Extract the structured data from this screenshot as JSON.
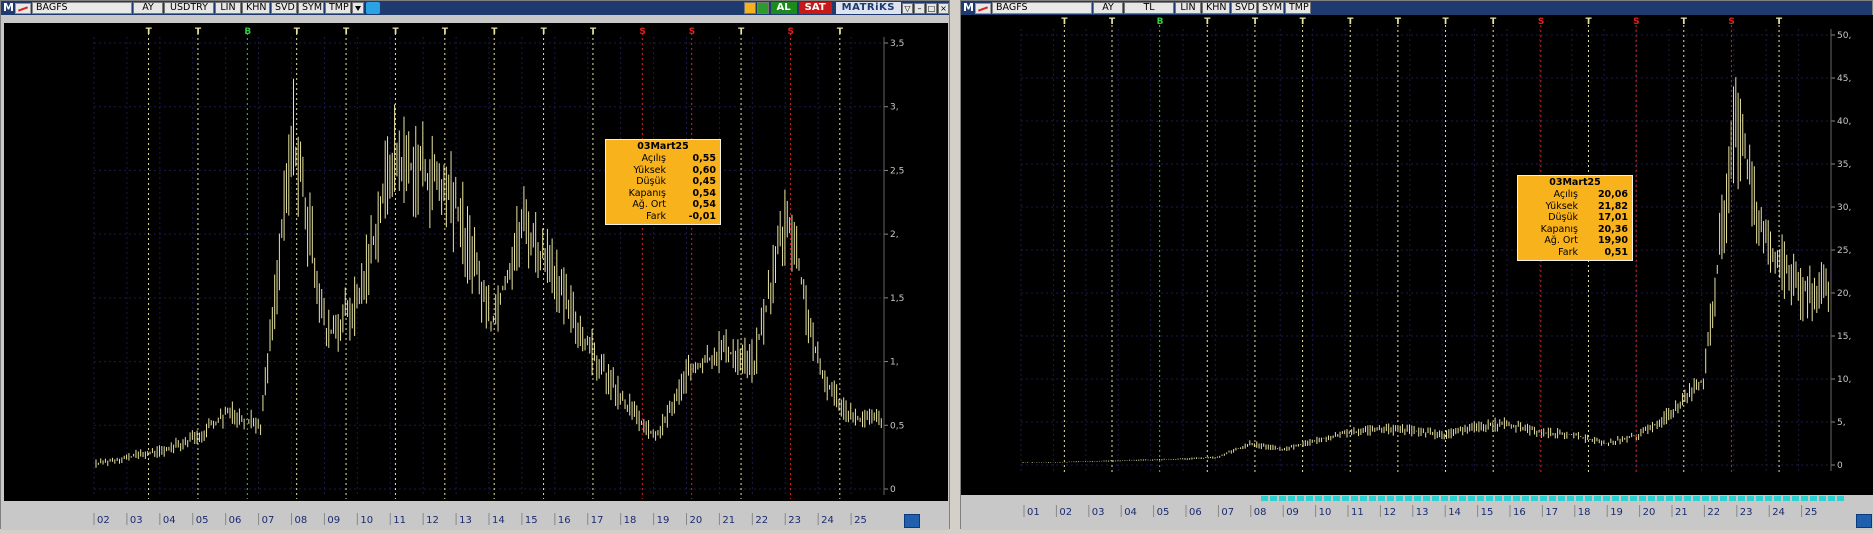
{
  "left": {
    "toolbar": {
      "logo": "M",
      "symbol": "BAGFS",
      "buttons": [
        "AY",
        "USDTRY",
        "LIN",
        "KHN",
        "SVD",
        "SYM",
        "TMP"
      ],
      "al": "AL",
      "sat": "SAT",
      "brand": "MATRiKS"
    },
    "y_ticks": [
      "0",
      "0,5",
      "1,",
      "1,5",
      "2,",
      "2,5",
      "3,",
      "3,5"
    ],
    "x_ticks": [
      "02",
      "03",
      "04",
      "05",
      "06",
      "07",
      "08",
      "09",
      "10",
      "11",
      "12",
      "13",
      "14",
      "15",
      "16",
      "17",
      "18",
      "19",
      "20",
      "21",
      "22",
      "23",
      "24",
      "25"
    ],
    "signals": [
      "T",
      "T",
      "B",
      "T",
      "T",
      "T",
      "T",
      "T",
      "T",
      "T",
      "S",
      "S",
      "T",
      "S",
      "T"
    ],
    "info": {
      "title": "03Mart25",
      "rows": [
        {
          "label": "Açılış",
          "value": "0,55"
        },
        {
          "label": "Yüksek",
          "value": "0,60"
        },
        {
          "label": "Düşük",
          "value": "0,45"
        },
        {
          "label": "Kapanış",
          "value": "0,54"
        },
        {
          "label": "Ağ. Ort",
          "value": "0,54"
        },
        {
          "label": "Fark",
          "value": "-0,01"
        }
      ]
    }
  },
  "right": {
    "toolbar": {
      "logo": "M",
      "symbol": "BAGFS",
      "buttons": [
        "AY",
        "TL",
        "LIN",
        "KHN",
        "SVD",
        "SYM",
        "TMP"
      ]
    },
    "y_ticks": [
      "0",
      "5,",
      "10,",
      "15,",
      "20,",
      "25,",
      "30,",
      "35,",
      "40,",
      "45,",
      "50,"
    ],
    "x_ticks": [
      "01",
      "02",
      "03",
      "04",
      "05",
      "06",
      "07",
      "08",
      "09",
      "10",
      "11",
      "12",
      "13",
      "14",
      "15",
      "16",
      "17",
      "18",
      "19",
      "20",
      "21",
      "22",
      "23",
      "24",
      "25"
    ],
    "signals": [
      "T",
      "T",
      "B",
      "T",
      "T",
      "T",
      "T",
      "T",
      "T",
      "T",
      "S",
      "T",
      "S",
      "T",
      "S",
      "T"
    ],
    "info": {
      "title": "03Mart25",
      "rows": [
        {
          "label": "Açılış",
          "value": "20,06"
        },
        {
          "label": "Yüksek",
          "value": "21,82"
        },
        {
          "label": "Düşük",
          "value": "17,01"
        },
        {
          "label": "Kapanış",
          "value": "20,36"
        },
        {
          "label": "Ağ. Ort",
          "value": "19,90"
        },
        {
          "label": "Fark",
          "value": "0,51"
        }
      ]
    }
  },
  "colors": {
    "background": "#000000",
    "price": "#e8e3a0",
    "signal_t": "#e8e3a0",
    "signal_b": "#2ecc40",
    "signal_s": "#e02020",
    "axis_text": "#c8c8c8",
    "info_box": "#f7b21c",
    "toolbar": "#1f3a6e"
  },
  "chart_data": [
    {
      "type": "bar",
      "name": "",
      "x": [
        "02",
        "03",
        "04",
        "05",
        "06",
        "07",
        "08",
        "09",
        "10",
        "11",
        "12",
        "13",
        "14",
        "15",
        "16",
        "17",
        "18",
        "19",
        "20",
        "21",
        "22",
        "23",
        "24",
        "25"
      ],
      "approx_close": [
        0.2,
        0.25,
        0.3,
        0.4,
        0.6,
        0.5,
        2.8,
        1.2,
        1.5,
        2.6,
        2.5,
        2.2,
        1.3,
        2.1,
        1.6,
        1.1,
        0.7,
        0.4,
        0.9,
        1.1,
        1.0,
        2.2,
        0.9,
        0.55
      ],
      "ylim": [
        0,
        3.5
      ]
    },
    {
      "type": "bar",
      "name": "",
      "x": [
        "01",
        "02",
        "03",
        "04",
        "05",
        "06",
        "07",
        "08",
        "09",
        "10",
        "11",
        "12",
        "13",
        "14",
        "15",
        "16",
        "17",
        "18",
        "19",
        "20",
        "21",
        "22",
        "23",
        "24",
        "25"
      ],
      "approx_close": [
        0.3,
        0.3,
        0.4,
        0.5,
        0.6,
        0.7,
        0.9,
        2.5,
        1.8,
        2.8,
        3.8,
        4.2,
        4.0,
        3.5,
        4.5,
        4.8,
        3.8,
        3.5,
        2.5,
        3.5,
        6.0,
        10.0,
        40.0,
        25.0,
        20.36
      ],
      "ylim": [
        0,
        50
      ]
    }
  ]
}
